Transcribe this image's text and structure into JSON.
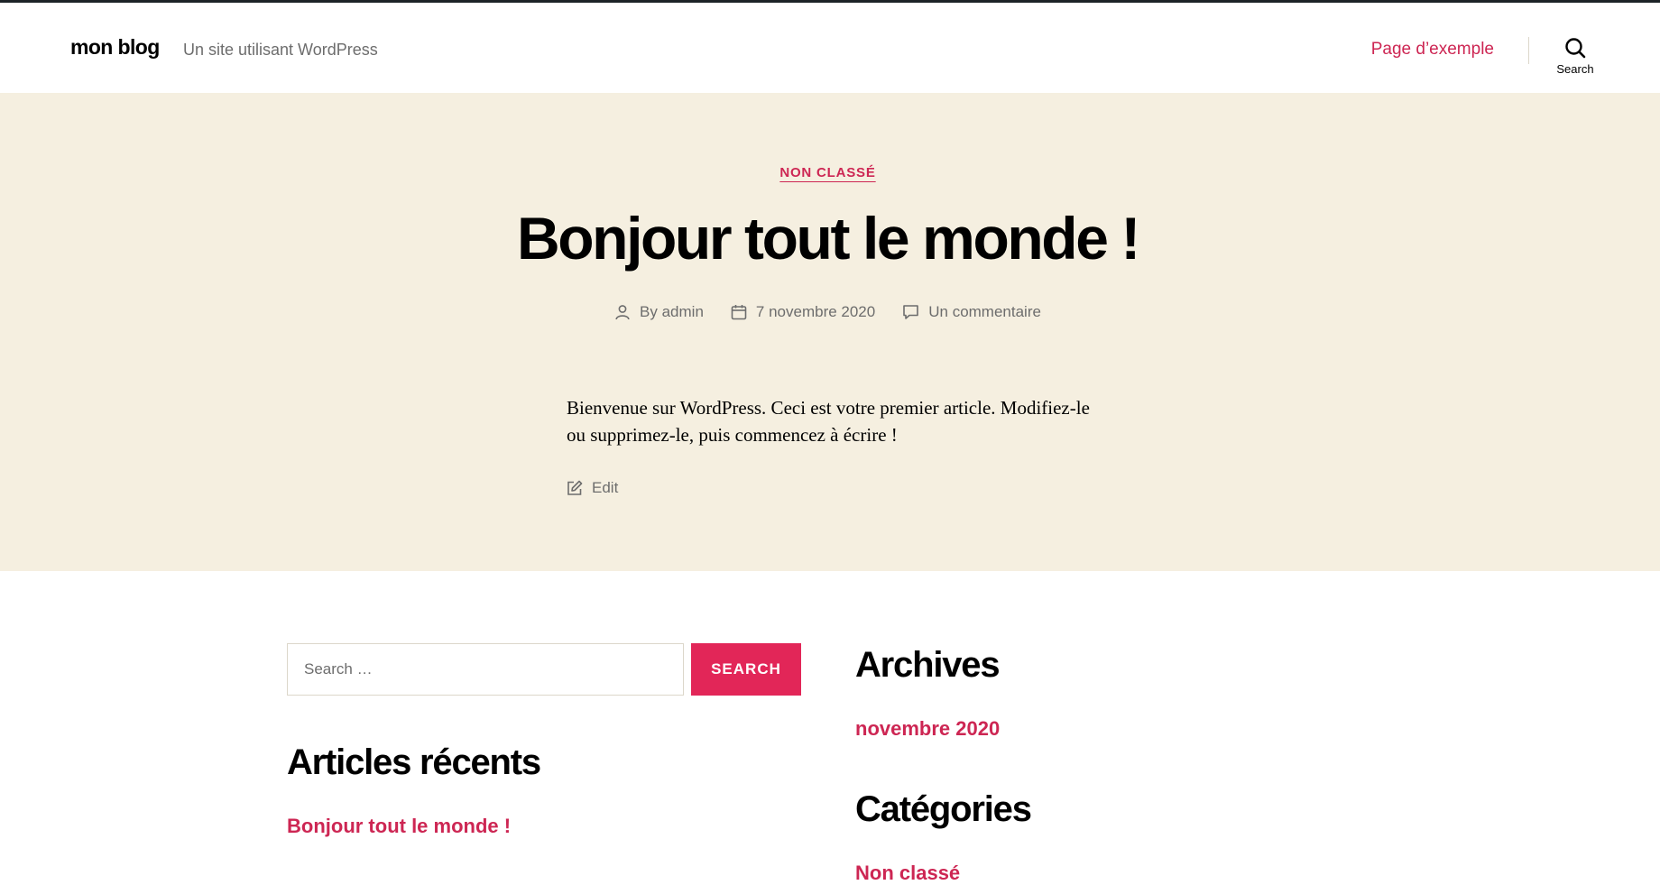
{
  "site": {
    "title": "mon blog",
    "description": "Un site utilisant WordPress"
  },
  "nav": {
    "items": [
      {
        "label": "Page d’exemple"
      }
    ]
  },
  "search_toggle": {
    "label": "Search",
    "icon": "search-icon"
  },
  "post": {
    "category": "NON CLASSÉ",
    "title": "Bonjour tout le monde !",
    "author": "By admin",
    "date": "7 novembre 2020",
    "comments": "Un commentaire",
    "content": "Bienvenue sur WordPress. Ceci est votre premier article. Modifiez-le ou supprimez-le, puis commencez à écrire !",
    "edit_label": "Edit"
  },
  "widgets": {
    "search": {
      "placeholder": "Search …",
      "button_label": "SEARCH"
    },
    "recent_posts": {
      "title": "Articles récents",
      "items": [
        "Bonjour tout le monde !"
      ]
    },
    "archives": {
      "title": "Archives",
      "items": [
        "novembre 2020"
      ]
    },
    "categories": {
      "title": "Catégories",
      "items": [
        "Non classé"
      ]
    }
  },
  "colors": {
    "accent": "#cd2653",
    "hero_background": "#f5efe0",
    "button": "#e22658",
    "muted_text": "#6d6d6d"
  }
}
